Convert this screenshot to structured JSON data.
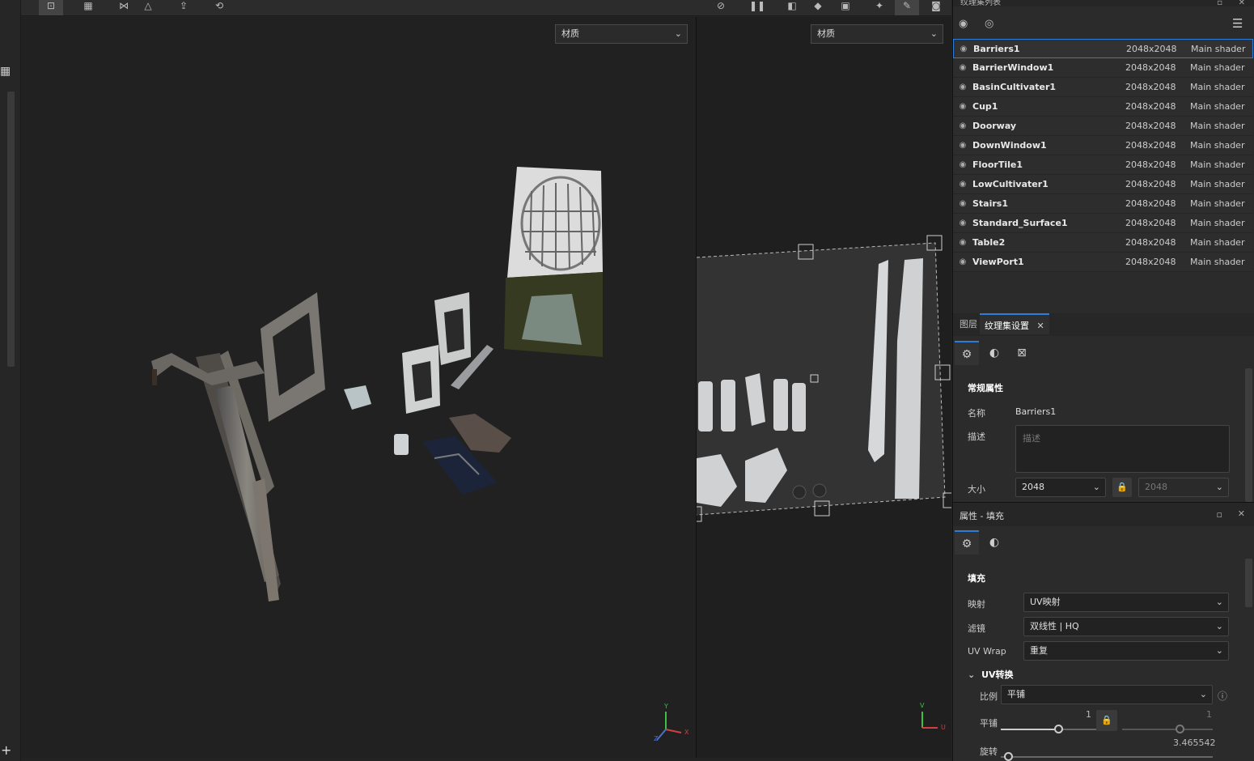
{
  "viewport3d": {
    "material_select": "材质"
  },
  "viewport2d": {
    "material_select": "材质"
  },
  "texture_set_list": {
    "title": "纹理集列表",
    "items": [
      {
        "name": "Barriers1",
        "size": "2048x2048",
        "shader": "Main shader"
      },
      {
        "name": "BarrierWindow1",
        "size": "2048x2048",
        "shader": "Main shader"
      },
      {
        "name": "BasinCultivater1",
        "size": "2048x2048",
        "shader": "Main shader"
      },
      {
        "name": "Cup1",
        "size": "2048x2048",
        "shader": "Main shader"
      },
      {
        "name": "Doorway",
        "size": "2048x2048",
        "shader": "Main shader"
      },
      {
        "name": "DownWindow1",
        "size": "2048x2048",
        "shader": "Main shader"
      },
      {
        "name": "FloorTile1",
        "size": "2048x2048",
        "shader": "Main shader"
      },
      {
        "name": "LowCultivater1",
        "size": "2048x2048",
        "shader": "Main shader"
      },
      {
        "name": "Stairs1",
        "size": "2048x2048",
        "shader": "Main shader"
      },
      {
        "name": "Standard_Surface1",
        "size": "2048x2048",
        "shader": "Main shader"
      },
      {
        "name": "Table2",
        "size": "2048x2048",
        "shader": "Main shader"
      },
      {
        "name": "ViewPort1",
        "size": "2048x2048",
        "shader": "Main shader"
      }
    ]
  },
  "tabs": {
    "layers": "图层",
    "texture_set_settings": "纹理集设置"
  },
  "general": {
    "section": "常规属性",
    "name_label": "名称",
    "name_value": "Barriers1",
    "desc_label": "描述",
    "desc_placeholder": "描述",
    "size_label": "大小",
    "size_value": "2048",
    "size_value2": "2048"
  },
  "properties": {
    "title": "属性 - 填充",
    "section": "填充",
    "mapping_label": "映射",
    "mapping_value": "UV映射",
    "filter_label": "滤镜",
    "filter_value": "双线性 | HQ",
    "uvwrap_label": "UV Wrap",
    "uvwrap_value": "重复",
    "uvtransform_label": "UV转换",
    "scale_label": "比例",
    "scale_value": "平铺",
    "tile_label": "平铺",
    "tile_value": "1",
    "tile_value2": "1",
    "rotation_label": "旋转",
    "rotation_value": "3.465542"
  },
  "axis": {
    "x": "X",
    "y": "Y",
    "z": "Z",
    "u": "U",
    "v": "V"
  },
  "colors": {
    "accent": "#2f7bd8",
    "panel": "#2b2b2b",
    "viewport": "#212121"
  }
}
